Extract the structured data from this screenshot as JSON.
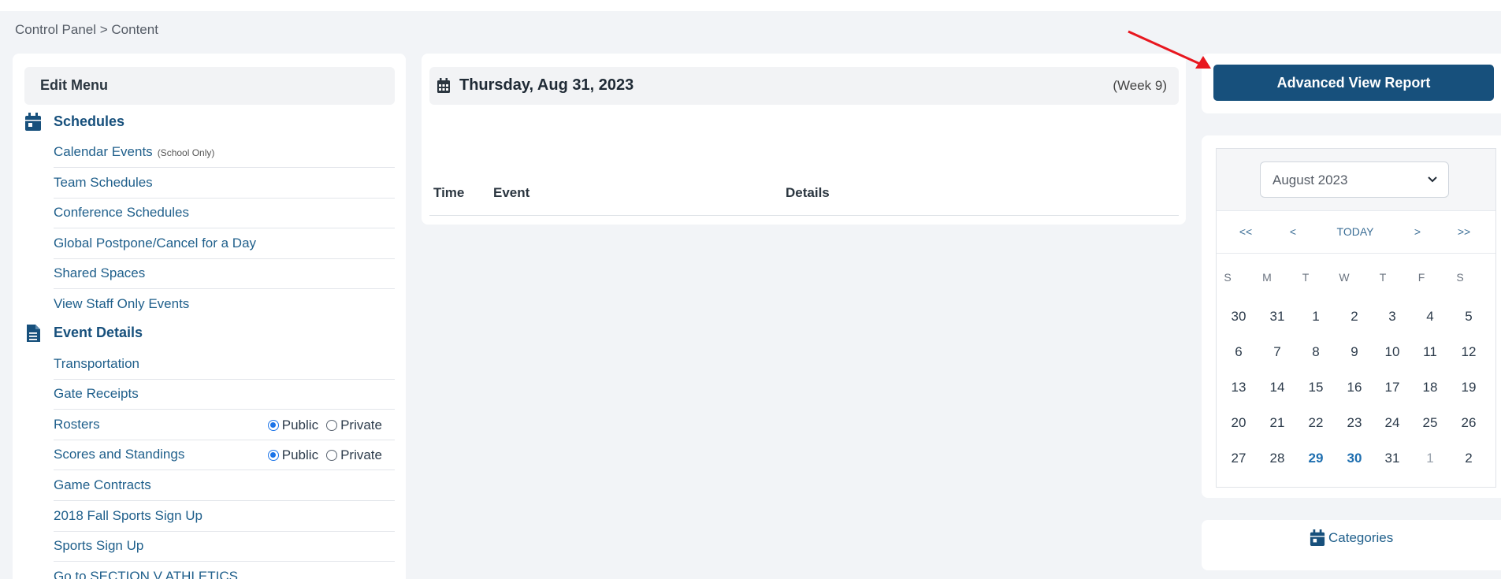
{
  "breadcrumb": "Control Panel > Content",
  "sidebar": {
    "header": "Edit Menu",
    "sections": {
      "schedules": "Schedules",
      "event_details": "Event Details"
    },
    "items": {
      "calendar_events": "Calendar Events",
      "calendar_events_note": "(School Only)",
      "team_schedules": "Team Schedules",
      "conference_schedules": "Conference Schedules",
      "global_postpone": "Global Postpone/Cancel for a Day",
      "shared_spaces": "Shared Spaces",
      "view_staff_events": "View Staff Only Events",
      "transportation": "Transportation",
      "gate_receipts": "Gate Receipts",
      "rosters": "Rosters",
      "scores_standings": "Scores and Standings",
      "game_contracts": "Game Contracts",
      "fall_signup": "2018 Fall Sports Sign Up",
      "sports_signup": "Sports Sign Up",
      "cut_off": "Go to SECTION V ATHLETICS"
    },
    "radio": {
      "public": "Public",
      "private": "Private"
    }
  },
  "center": {
    "date": "Thursday, Aug 31, 2023",
    "week": "(Week 9)",
    "columns": {
      "time": "Time",
      "event": "Event",
      "details": "Details"
    }
  },
  "report_button": "Advanced View Report",
  "calendar": {
    "month": "August 2023",
    "nav": {
      "first": "<<",
      "prev": "<",
      "today": "TODAY",
      "next": ">",
      "last": ">>"
    },
    "dow": [
      "S",
      "M",
      "T",
      "W",
      "T",
      "F",
      "S"
    ],
    "weeks": [
      [
        "30",
        "31",
        "1",
        "2",
        "3",
        "4",
        "5"
      ],
      [
        "6",
        "7",
        "8",
        "9",
        "10",
        "11",
        "12"
      ],
      [
        "13",
        "14",
        "15",
        "16",
        "17",
        "18",
        "19"
      ],
      [
        "20",
        "21",
        "22",
        "23",
        "24",
        "25",
        "26"
      ],
      [
        "27",
        "28",
        "29",
        "30",
        "31",
        "1",
        "2"
      ]
    ]
  },
  "categories_link": "Categories",
  "colors": {
    "brand": "#17507c",
    "link": "#1f5f8b",
    "accent_day": "#1f6fb0",
    "arrow": "#e8171f"
  }
}
